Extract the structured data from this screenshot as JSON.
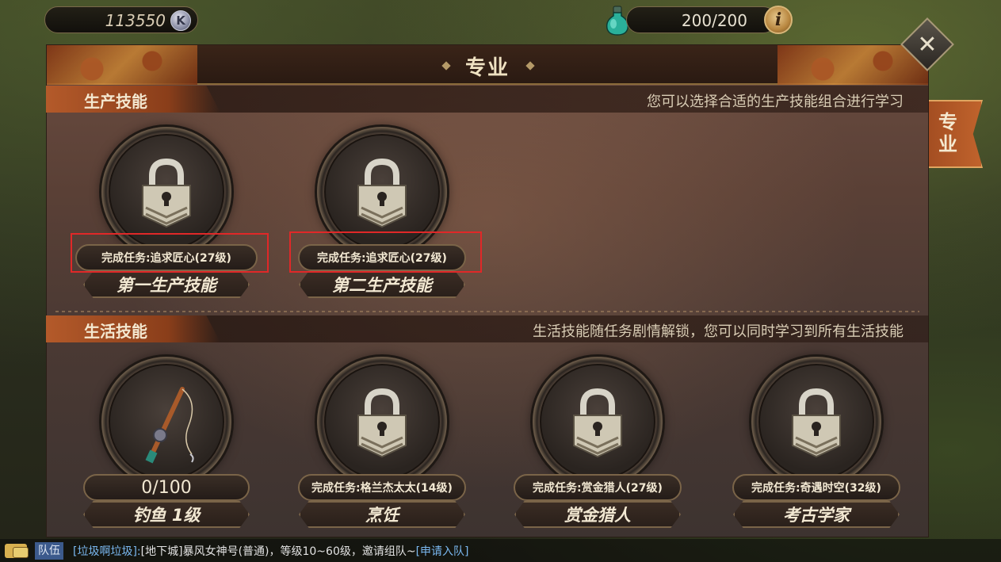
{
  "hud": {
    "currency_value": "113550",
    "currency_icon_letter": "K",
    "stamina_value": "200/200",
    "info_icon_glyph": "i"
  },
  "panel": {
    "title": "专业",
    "side_tab_label": "专业",
    "close_glyph": "✕"
  },
  "production": {
    "title": "生产技能",
    "description": "您可以选择合适的生产技能组合进行学习",
    "slots": [
      {
        "requirement": "完成任务:追求匠心(27级)",
        "name": "第一生产技能",
        "icon": "lock-icon"
      },
      {
        "requirement": "完成任务:追求匠心(27级)",
        "name": "第二生产技能",
        "icon": "lock-icon"
      }
    ]
  },
  "life": {
    "title": "生活技能",
    "description": "生活技能随任务剧情解锁，您可以同时学习到所有生活技能",
    "slots": [
      {
        "progress": "0/100",
        "name": "钓鱼  1级",
        "icon": "fishing-rod-icon"
      },
      {
        "requirement": "完成任务:格兰杰太太(14级)",
        "name": "烹饪",
        "icon": "lock-icon"
      },
      {
        "requirement": "完成任务:赏金猎人(27级)",
        "name": "赏金猎人",
        "icon": "lock-icon"
      },
      {
        "requirement": "完成任务:奇遇时空(32级)",
        "name": "考古学家",
        "icon": "lock-icon"
      }
    ]
  },
  "chat": {
    "channel": "队伍",
    "sender": "[垃圾啊垃圾]:",
    "message": "[地下城]暴风女神号(普通)，等级10~60级，邀请组队~",
    "link": "[申请入队]"
  },
  "colors": {
    "highlight_box": "#e02828",
    "section_tag": "#b45a2a",
    "chat_link": "#7ab8f0"
  }
}
